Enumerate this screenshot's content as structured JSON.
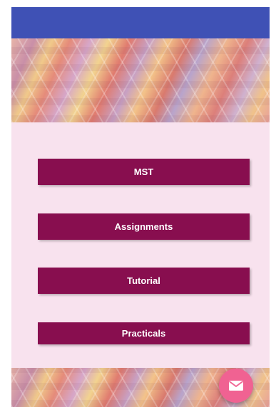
{
  "buttons": {
    "mst": "MST",
    "assignments": "Assignments",
    "tutorial": "Tutorial",
    "practicals": "Practicals"
  },
  "fab": {
    "icon": "mail-icon"
  },
  "colors": {
    "app_bar": "#3f51b5",
    "background": "#f8e2ee",
    "button": "#880e4f",
    "fab": "#f06292"
  }
}
